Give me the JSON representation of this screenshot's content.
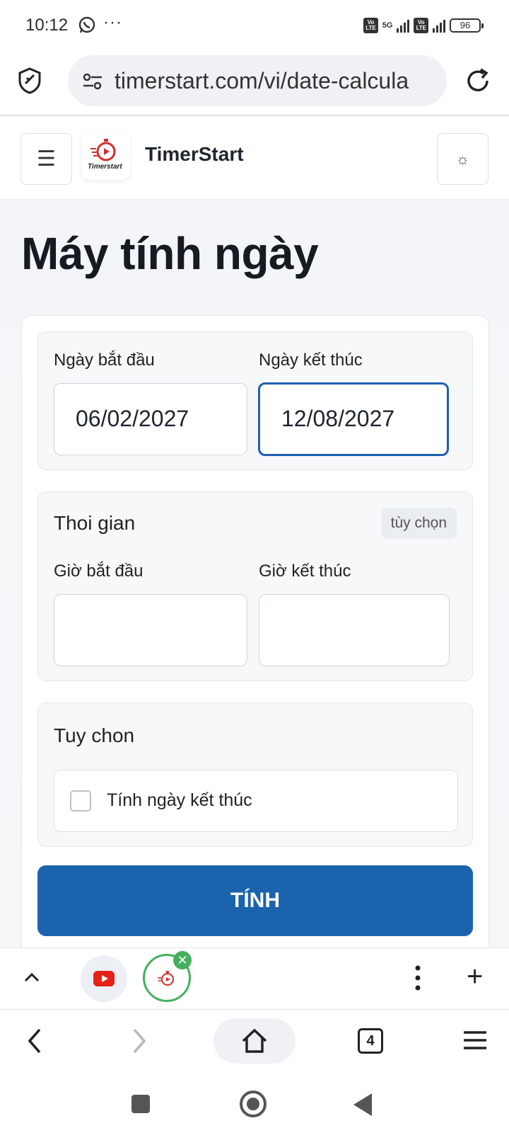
{
  "status_bar": {
    "time": "10:12",
    "network_label": "5G",
    "volte_label": "Vo LTE",
    "battery": "96"
  },
  "browser": {
    "url": "timerstart.com/vi/date-calcula"
  },
  "site_header": {
    "brand": "TimerStart",
    "logo_text": "Timerstart",
    "menu_icon": "☰",
    "theme_icon": "☼"
  },
  "page": {
    "title": "Máy tính ngày"
  },
  "dates": {
    "start_label": "Ngày bắt đầu",
    "start_value": "06/02/2027",
    "end_label": "Ngày kết thúc",
    "end_value": "12/08/2027"
  },
  "time_section": {
    "title": "Thoi gian",
    "badge": "tùy chọn",
    "start_label": "Giờ bắt đầu",
    "start_value": "",
    "end_label": "Giờ kết thúc",
    "end_value": ""
  },
  "options_section": {
    "title": "Tuy chon",
    "checkbox_label": "Tính ngày kết thúc",
    "checked": false
  },
  "calc_button": "TÍNH",
  "tab_strip": {
    "tab_count": "4",
    "close_icon": "✕",
    "plus_icon": "+"
  },
  "colors": {
    "accent": "#1b63ad",
    "active_border": "#1f5fb0",
    "tab_active": "#44b05e"
  }
}
